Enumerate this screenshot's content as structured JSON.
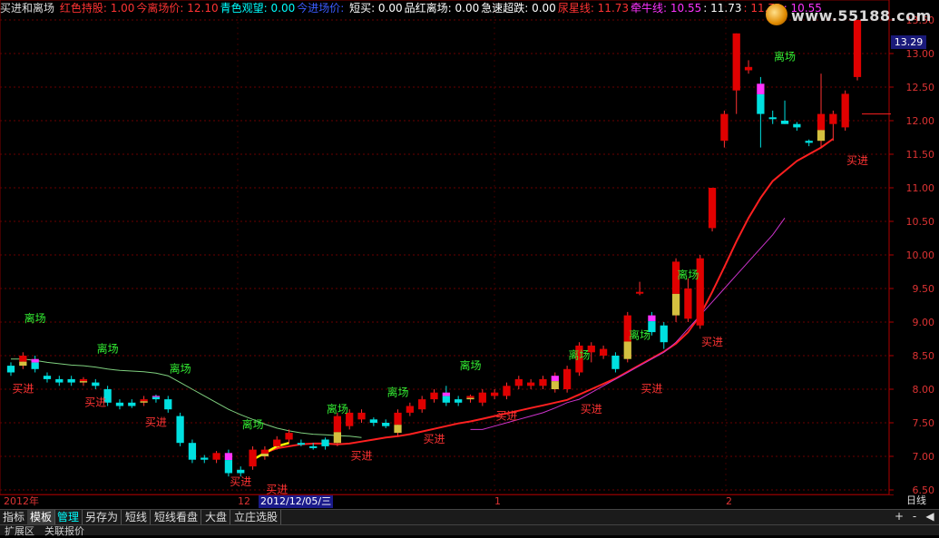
{
  "header": {
    "title": "买进和离场",
    "items": [
      {
        "label": "红色持股:",
        "value": "1.00",
        "color": "#ff3333"
      },
      {
        "label": "今离场价:",
        "value": "12.10",
        "color": "#ff3333"
      },
      {
        "label": "青色观望:",
        "value": "0.00",
        "color": "#00ffff"
      },
      {
        "label": "今进场价:",
        "value": "",
        "color": "#3b5bff"
      },
      {
        "label": "短买:",
        "value": "0.00",
        "color": "#ffffff"
      },
      {
        "label": "品红离场:",
        "value": "0.00",
        "color": "#ffffff"
      },
      {
        "label": "急速超跌:",
        "value": "0.00",
        "color": "#ffffff"
      },
      {
        "label": "尿星线:",
        "value": "11.73",
        "color": "#ff3333"
      },
      {
        "label": "牵牛线:",
        "value": "10.55",
        "color": "#ff33ff"
      },
      {
        "label": ":",
        "value": "11.73",
        "color": "#ffffff"
      },
      {
        "label": ":",
        "value": "11.73",
        "color": "#ff3333"
      },
      {
        "label": ":",
        "value": "10.55",
        "color": "#ff33ff"
      }
    ]
  },
  "watermark": {
    "text": "www.55188.com",
    "icon": "gold-coin-icon"
  },
  "chart_data": {
    "type": "candlestick",
    "ylim": [
      6.5,
      13.5
    ],
    "yticks": [
      "6.50",
      "7.00",
      "7.50",
      "8.00",
      "8.50",
      "9.00",
      "9.50",
      "10.00",
      "10.50",
      "11.00",
      "11.50",
      "12.00",
      "12.50",
      "13.00",
      "13.50"
    ],
    "current_price": "13.29",
    "candles": [
      [
        8.25,
        8.35,
        8.4,
        8.2,
        "cyan"
      ],
      [
        8.35,
        8.5,
        8.55,
        8.3,
        "redyellow"
      ],
      [
        8.45,
        8.3,
        8.5,
        8.25,
        "magentacyan"
      ],
      [
        8.2,
        8.15,
        8.25,
        8.1,
        "cyan"
      ],
      [
        8.15,
        8.1,
        8.2,
        8.05,
        "cyan"
      ],
      [
        8.1,
        8.15,
        8.2,
        8.05,
        "cyan"
      ],
      [
        8.1,
        8.15,
        8.18,
        8.05,
        "redyellow"
      ],
      [
        8.1,
        8.05,
        8.15,
        8.0,
        "cyan"
      ],
      [
        8.0,
        7.8,
        8.05,
        7.75,
        "cyan"
      ],
      [
        7.8,
        7.75,
        7.85,
        7.7,
        "cyan"
      ],
      [
        7.75,
        7.8,
        7.85,
        7.72,
        "cyan"
      ],
      [
        7.8,
        7.85,
        7.9,
        7.75,
        "redyellow"
      ],
      [
        7.85,
        7.9,
        7.92,
        7.8,
        "magentacyan"
      ],
      [
        7.85,
        7.7,
        7.9,
        7.65,
        "cyan"
      ],
      [
        7.6,
        7.2,
        7.65,
        7.15,
        "cyan"
      ],
      [
        7.2,
        6.95,
        7.25,
        6.9,
        "cyan"
      ],
      [
        6.95,
        6.98,
        7.02,
        6.9,
        "cyan"
      ],
      [
        6.95,
        7.05,
        7.08,
        6.9,
        "red"
      ],
      [
        7.05,
        6.75,
        7.1,
        6.7,
        "magentacyan"
      ],
      [
        6.75,
        6.8,
        6.85,
        6.7,
        "cyan"
      ],
      [
        6.85,
        7.1,
        7.15,
        6.8,
        "red"
      ],
      [
        7.0,
        7.1,
        7.15,
        6.95,
        "redyellow"
      ],
      [
        7.15,
        7.25,
        7.3,
        7.1,
        "red"
      ],
      [
        7.25,
        7.35,
        7.4,
        7.2,
        "red"
      ],
      [
        7.2,
        7.2,
        7.25,
        7.15,
        "cyan"
      ],
      [
        7.15,
        7.15,
        7.2,
        7.1,
        "cyan"
      ],
      [
        7.15,
        7.25,
        7.28,
        7.1,
        "cyan"
      ],
      [
        7.2,
        7.6,
        7.65,
        7.15,
        "redyellow"
      ],
      [
        7.65,
        7.45,
        7.7,
        7.4,
        "red"
      ],
      [
        7.55,
        7.65,
        7.7,
        7.5,
        "red"
      ],
      [
        7.55,
        7.5,
        7.58,
        7.45,
        "cyan"
      ],
      [
        7.5,
        7.45,
        7.55,
        7.42,
        "cyan"
      ],
      [
        7.35,
        7.65,
        7.7,
        7.3,
        "redyellow"
      ],
      [
        7.65,
        7.75,
        7.8,
        7.6,
        "red"
      ],
      [
        7.7,
        7.85,
        7.9,
        7.65,
        "red"
      ],
      [
        7.85,
        7.95,
        8.0,
        7.8,
        "red"
      ],
      [
        7.95,
        7.8,
        8.05,
        7.75,
        "magentacyan"
      ],
      [
        7.8,
        7.85,
        7.9,
        7.75,
        "cyan"
      ],
      [
        7.85,
        7.9,
        7.92,
        7.8,
        "redyellow"
      ],
      [
        7.8,
        7.95,
        8.0,
        7.75,
        "red"
      ],
      [
        7.95,
        7.9,
        8.0,
        7.85,
        "red"
      ],
      [
        7.9,
        8.05,
        8.1,
        7.85,
        "red"
      ],
      [
        8.05,
        8.15,
        8.2,
        8.0,
        "red"
      ],
      [
        8.1,
        8.05,
        8.15,
        8.0,
        "red"
      ],
      [
        8.05,
        8.15,
        8.2,
        8.0,
        "red"
      ],
      [
        8.0,
        8.2,
        8.25,
        7.95,
        "magentayellow"
      ],
      [
        8.0,
        8.3,
        8.35,
        7.95,
        "red"
      ],
      [
        8.25,
        8.65,
        8.7,
        8.2,
        "red"
      ],
      [
        8.55,
        8.65,
        8.7,
        8.4,
        "red"
      ],
      [
        8.6,
        8.5,
        8.65,
        8.45,
        "red"
      ],
      [
        8.5,
        8.3,
        8.55,
        8.25,
        "cyan"
      ],
      [
        8.45,
        9.1,
        9.15,
        8.4,
        "redyellow"
      ],
      [
        9.45,
        9.45,
        9.6,
        9.4,
        "red"
      ],
      [
        9.1,
        8.85,
        9.15,
        8.8,
        "magentacyan"
      ],
      [
        8.95,
        8.7,
        9.0,
        8.6,
        "cyan"
      ],
      [
        9.1,
        9.9,
        9.95,
        9.0,
        "redyellow"
      ],
      [
        9.05,
        9.5,
        9.65,
        9.0,
        "red"
      ],
      [
        8.95,
        9.95,
        10.0,
        8.9,
        "red"
      ],
      [
        10.4,
        11.0,
        11.0,
        10.35,
        "red"
      ],
      [
        11.7,
        12.1,
        12.15,
        11.6,
        "red"
      ],
      [
        12.45,
        13.3,
        13.3,
        12.1,
        "red"
      ],
      [
        12.75,
        12.8,
        12.9,
        12.7,
        "red"
      ],
      [
        12.55,
        12.1,
        12.65,
        11.6,
        "magentacyan"
      ],
      [
        12.05,
        12.05,
        12.15,
        11.95,
        "cyan"
      ],
      [
        12.0,
        11.95,
        12.3,
        11.95,
        "cyan"
      ],
      [
        11.95,
        11.9,
        11.98,
        11.85,
        "cyan"
      ],
      [
        11.7,
        11.67,
        11.72,
        11.62,
        "cyan"
      ],
      [
        11.7,
        12.1,
        12.7,
        11.6,
        "redyellow"
      ],
      [
        11.95,
        12.1,
        12.15,
        11.7,
        "red"
      ],
      [
        11.9,
        12.4,
        12.45,
        11.85,
        "red"
      ],
      [
        12.65,
        13.5,
        13.5,
        12.6,
        "red"
      ]
    ],
    "series": [
      {
        "name": "尿星线",
        "color": "#ff2020",
        "values": [
          null,
          null,
          null,
          null,
          null,
          null,
          null,
          null,
          null,
          null,
          null,
          null,
          null,
          null,
          null,
          null,
          null,
          null,
          null,
          null,
          6.95,
          7.05,
          7.12,
          7.15,
          7.18,
          7.19,
          7.19,
          7.18,
          7.19,
          7.22,
          7.25,
          7.28,
          7.3,
          7.33,
          7.37,
          7.41,
          7.45,
          7.49,
          7.52,
          7.56,
          7.6,
          7.64,
          7.68,
          7.72,
          7.76,
          7.8,
          7.84,
          7.92,
          8.0,
          8.08,
          8.16,
          8.26,
          8.36,
          8.46,
          8.56,
          8.68,
          8.85,
          9.1,
          9.45,
          9.82,
          10.2,
          10.55,
          10.85,
          11.1,
          11.25,
          11.4,
          11.5,
          11.6,
          11.73
        ]
      },
      {
        "name": "牵牛线",
        "color": "#cc33cc",
        "values": [
          null,
          null,
          null,
          null,
          null,
          null,
          null,
          null,
          null,
          null,
          null,
          null,
          null,
          null,
          null,
          null,
          null,
          null,
          null,
          null,
          null,
          null,
          null,
          null,
          null,
          null,
          null,
          null,
          null,
          null,
          null,
          null,
          null,
          null,
          null,
          null,
          null,
          null,
          7.4,
          7.4,
          7.45,
          7.5,
          7.55,
          7.6,
          7.65,
          7.72,
          7.8,
          7.85,
          7.95,
          8.05,
          8.15,
          8.25,
          8.35,
          8.45,
          8.55,
          8.7,
          8.9,
          9.1,
          9.3,
          9.5,
          9.7,
          9.9,
          10.1,
          10.3,
          10.55
        ]
      },
      {
        "name": "",
        "color": "#7fd07f",
        "values": [
          8.45,
          8.45,
          8.43,
          8.4,
          8.38,
          8.36,
          8.35,
          8.33,
          8.3,
          8.28,
          8.27,
          8.26,
          8.24,
          8.2,
          8.1,
          8.0,
          7.9,
          7.8,
          7.7,
          7.62,
          7.55,
          7.48,
          7.42,
          7.38,
          7.35,
          7.33,
          7.32,
          7.31,
          7.3,
          7.28
        ]
      },
      {
        "name": "",
        "color": "#ffff00",
        "values": [
          null,
          null,
          null,
          null,
          null,
          null,
          null,
          null,
          null,
          null,
          null,
          null,
          null,
          null,
          null,
          null,
          null,
          null,
          null,
          null,
          6.95,
          7.05,
          7.15,
          7.2
        ]
      }
    ],
    "signals": [
      {
        "text": "离场",
        "color": "#33ee33",
        "i": 2,
        "price": 9.0
      },
      {
        "text": "买进",
        "color": "#ff3333",
        "i": 1,
        "price": 7.95
      },
      {
        "text": "离场",
        "color": "#33ee33",
        "i": 8,
        "price": 8.55
      },
      {
        "text": "买进",
        "color": "#ff3333",
        "i": 7,
        "price": 7.75
      },
      {
        "text": "离场",
        "color": "#33ee33",
        "i": 14,
        "price": 8.25
      },
      {
        "text": "买进",
        "color": "#ff3333",
        "i": 12,
        "price": 7.45
      },
      {
        "text": "离场",
        "color": "#33ee33",
        "i": 20,
        "price": 7.42
      },
      {
        "text": "买进",
        "color": "#ff3333",
        "i": 19,
        "price": 6.57
      },
      {
        "text": "买进",
        "color": "#ff3333",
        "i": 22,
        "price": 6.45
      },
      {
        "text": "离场",
        "color": "#33ee33",
        "i": 27,
        "price": 7.65
      },
      {
        "text": "买进",
        "color": "#ff3333",
        "i": 29,
        "price": 6.95
      },
      {
        "text": "离场",
        "color": "#33ee33",
        "i": 32,
        "price": 7.9
      },
      {
        "text": "买进",
        "color": "#ff3333",
        "i": 35,
        "price": 7.2
      },
      {
        "text": "离场",
        "color": "#33ee33",
        "i": 38,
        "price": 8.3
      },
      {
        "text": "买进",
        "color": "#ff3333",
        "i": 41,
        "price": 7.55
      },
      {
        "text": "离场",
        "color": "#33ee33",
        "i": 47,
        "price": 8.45
      },
      {
        "text": "买进",
        "color": "#ff3333",
        "i": 48,
        "price": 7.65
      },
      {
        "text": "离场",
        "color": "#33ee33",
        "i": 52,
        "price": 8.75
      },
      {
        "text": "买进",
        "color": "#ff3333",
        "i": 53,
        "price": 7.95
      },
      {
        "text": "离场",
        "color": "#33ee33",
        "i": 56,
        "price": 9.65
      },
      {
        "text": "买进",
        "color": "#ff3333",
        "i": 58,
        "price": 8.65
      },
      {
        "text": "离场",
        "color": "#33ee33",
        "i": 64,
        "price": 12.9
      },
      {
        "text": "买进",
        "color": "#ff3333",
        "i": 70,
        "price": 11.35
      }
    ],
    "x_axis": {
      "year": "2012年",
      "ticks": [
        "12",
        "1",
        "2"
      ],
      "cursor_date": "2012/12/05/三"
    }
  },
  "period": "日线",
  "toolbar": {
    "tabs": [
      "指标",
      "模板",
      "管理",
      "另存为",
      "短线",
      "短线看盘",
      "大盘",
      "立庄选股"
    ],
    "controls": [
      "+",
      "-",
      "◀"
    ]
  },
  "bottom_tabs": [
    "扩展区",
    "关联报价"
  ]
}
